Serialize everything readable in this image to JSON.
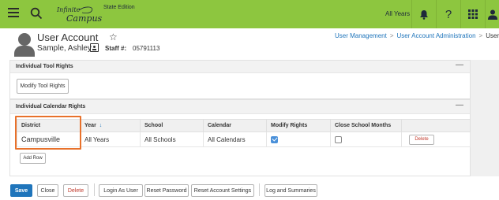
{
  "topbar": {
    "logo_line1": "Infinite",
    "logo_line2": "Campus",
    "edition": "State Edition",
    "year_selector": "All Years",
    "help_icon_label": "?",
    "icons": [
      "menu-icon",
      "search-icon",
      "bell-icon",
      "help-icon",
      "apps-grid-icon",
      "user-icon"
    ]
  },
  "header": {
    "title": "User Account",
    "star": "☆",
    "person_name": "Sample, Ashley",
    "staff_label": "Staff #:",
    "staff_number": "05791113"
  },
  "breadcrumb": {
    "items": [
      "User Management",
      "User Account Administration",
      "User Account"
    ],
    "separator": ">"
  },
  "tool_rights": {
    "heading": "Individual Tool Rights",
    "collapse": "—",
    "modify_button": "Modify Tool Rights"
  },
  "calendar_rights": {
    "heading": "Individual Calendar Rights",
    "collapse": "—",
    "columns": [
      "District",
      "Year",
      "School",
      "Calendar",
      "Modify Rights",
      "Close School Months",
      ""
    ],
    "sort_indicator": "↓",
    "rows": [
      {
        "district": "Campusville",
        "year": "All Years",
        "school": "All Schools",
        "calendar": "All Calendars",
        "modify_rights": true,
        "close_school_months": false,
        "delete_label": "Delete"
      }
    ],
    "add_row_button": "Add Row"
  },
  "action_bar": {
    "save": "Save",
    "close": "Close",
    "delete": "Delete",
    "login_as_user": "Login As User",
    "reset_password": "Reset Password",
    "reset_account_settings": "Reset Account Settings",
    "log_and_summaries": "Log and Summaries"
  },
  "colors": {
    "topbar": "#8dc63f",
    "primary": "#1f75bb",
    "highlight": "#e8712b",
    "danger": "#c0392b"
  }
}
